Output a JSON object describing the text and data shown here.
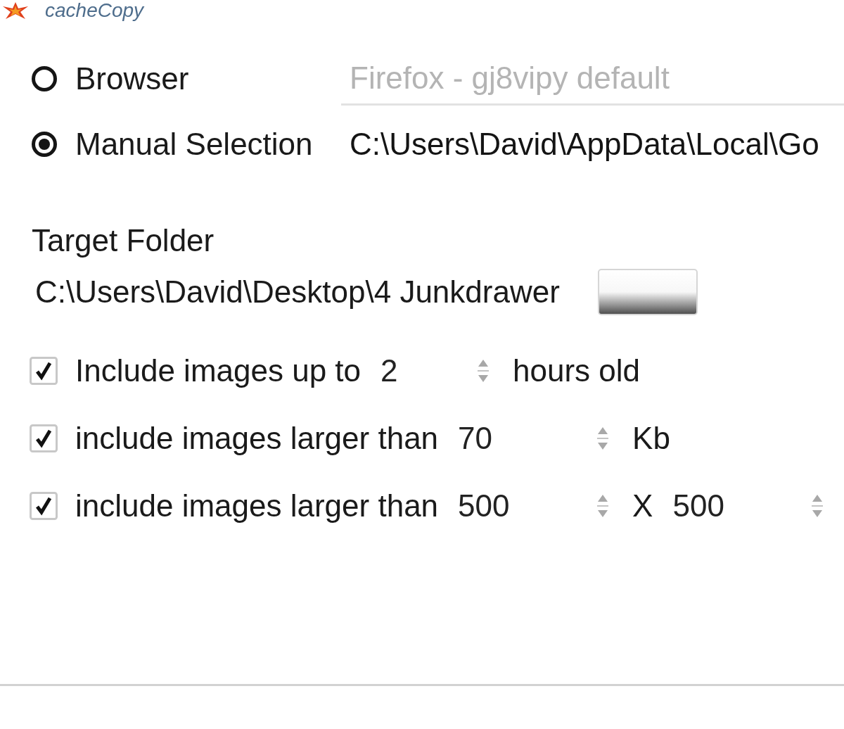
{
  "window": {
    "title": "cacheCopy"
  },
  "source": {
    "options": [
      {
        "label": "Browser",
        "selected": false,
        "kind": "dropdown",
        "value": "Firefox - gj8vipy default",
        "disabled": true
      },
      {
        "label": "Manual Selection",
        "selected": true,
        "kind": "path",
        "value": "C:\\Users\\David\\AppData\\Local\\Go",
        "disabled": false
      }
    ]
  },
  "target_folder": {
    "label": "Target Folder",
    "path": "C:\\Users\\David\\Desktop\\4 Junkdrawer"
  },
  "filters": [
    {
      "checked": true,
      "parts": [
        {
          "kind": "text",
          "text": "Include images up to"
        },
        {
          "kind": "spin",
          "value": "2"
        },
        {
          "kind": "text",
          "text": "hours old"
        }
      ]
    },
    {
      "checked": true,
      "parts": [
        {
          "kind": "text",
          "text": "include images larger than"
        },
        {
          "kind": "spin",
          "value": "70"
        },
        {
          "kind": "text",
          "text": "Kb"
        }
      ]
    },
    {
      "checked": true,
      "parts": [
        {
          "kind": "text",
          "text": "include images larger than"
        },
        {
          "kind": "spin",
          "value": "500"
        },
        {
          "kind": "text",
          "text": "X"
        },
        {
          "kind": "spin",
          "value": "500"
        }
      ]
    }
  ]
}
